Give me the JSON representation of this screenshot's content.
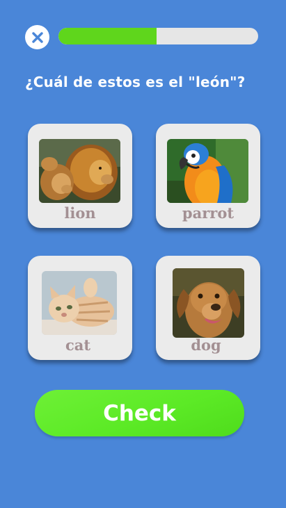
{
  "header": {
    "close_icon": "close-x-icon",
    "progress_percent": 49,
    "colors": {
      "progress_fill": "#5fd61c",
      "track": "#e6e6e6",
      "close_x": "#4a86d8"
    }
  },
  "question": {
    "text": "¿Cuál de estos es el \"león\"?"
  },
  "options": [
    {
      "label": "lion",
      "photo": "lion-photo"
    },
    {
      "label": "parrot",
      "photo": "parrot-photo"
    },
    {
      "label": "cat",
      "photo": "cat-photo"
    },
    {
      "label": "dog",
      "photo": "dog-photo"
    }
  ],
  "footer": {
    "check_label": "Check"
  },
  "colors": {
    "background": "#4a86d8",
    "card": "#ebebeb",
    "card_label": "#a39093",
    "check_button": "#5cea26"
  }
}
